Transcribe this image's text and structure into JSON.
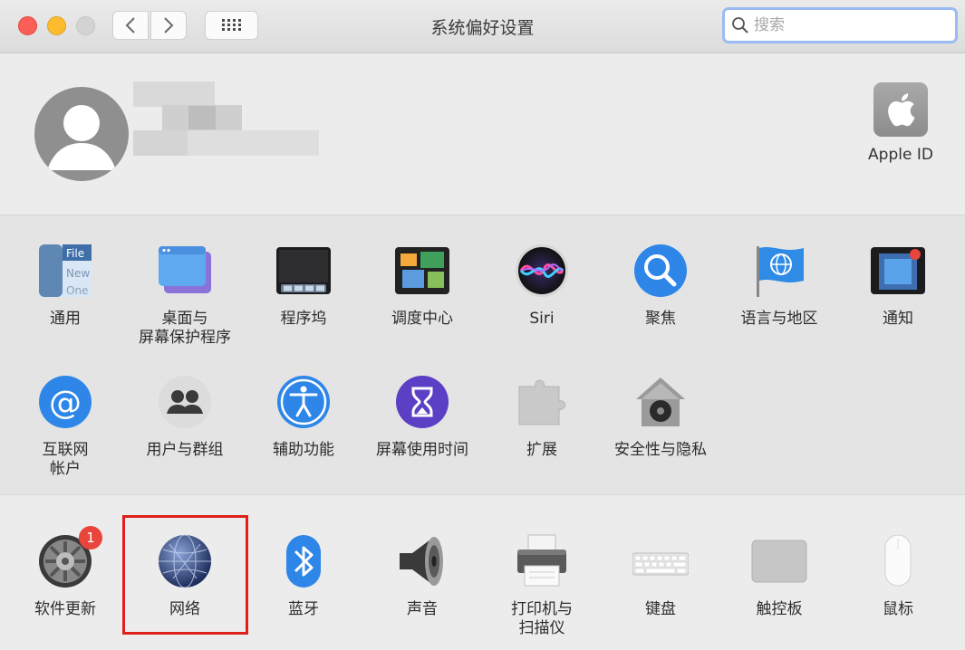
{
  "window": {
    "title": "系统偏好设置"
  },
  "search": {
    "placeholder": "搜索"
  },
  "apple_id": {
    "label": "Apple ID"
  },
  "row1": [
    {
      "label": "通用",
      "icon": "general-icon"
    },
    {
      "label": "桌面与\n屏幕保护程序",
      "icon": "desktop-screensaver-icon"
    },
    {
      "label": "程序坞",
      "icon": "dock-icon"
    },
    {
      "label": "调度中心",
      "icon": "mission-control-icon"
    },
    {
      "label": "Siri",
      "icon": "siri-icon"
    },
    {
      "label": "聚焦",
      "icon": "spotlight-icon"
    },
    {
      "label": "语言与地区",
      "icon": "language-region-icon"
    },
    {
      "label": "通知",
      "icon": "notifications-icon"
    }
  ],
  "row2": [
    {
      "label": "互联网\n帐户",
      "icon": "internet-accounts-icon"
    },
    {
      "label": "用户与群组",
      "icon": "users-groups-icon"
    },
    {
      "label": "辅助功能",
      "icon": "accessibility-icon"
    },
    {
      "label": "屏幕使用时间",
      "icon": "screen-time-icon"
    },
    {
      "label": "扩展",
      "icon": "extensions-icon"
    },
    {
      "label": "安全性与隐私",
      "icon": "security-privacy-icon"
    }
  ],
  "row3": [
    {
      "label": "软件更新",
      "icon": "software-update-icon",
      "badge": "1"
    },
    {
      "label": "网络",
      "icon": "network-icon"
    },
    {
      "label": "蓝牙",
      "icon": "bluetooth-icon"
    },
    {
      "label": "声音",
      "icon": "sound-icon"
    },
    {
      "label": "打印机与\n扫描仪",
      "icon": "printers-scanners-icon"
    },
    {
      "label": "键盘",
      "icon": "keyboard-icon"
    },
    {
      "label": "触控板",
      "icon": "trackpad-icon"
    },
    {
      "label": "鼠标",
      "icon": "mouse-icon"
    }
  ],
  "file_icon": {
    "line1": "File",
    "line2": "New",
    "line3": "One"
  },
  "highlight": {
    "target": "网络",
    "color": "#e0201a"
  }
}
